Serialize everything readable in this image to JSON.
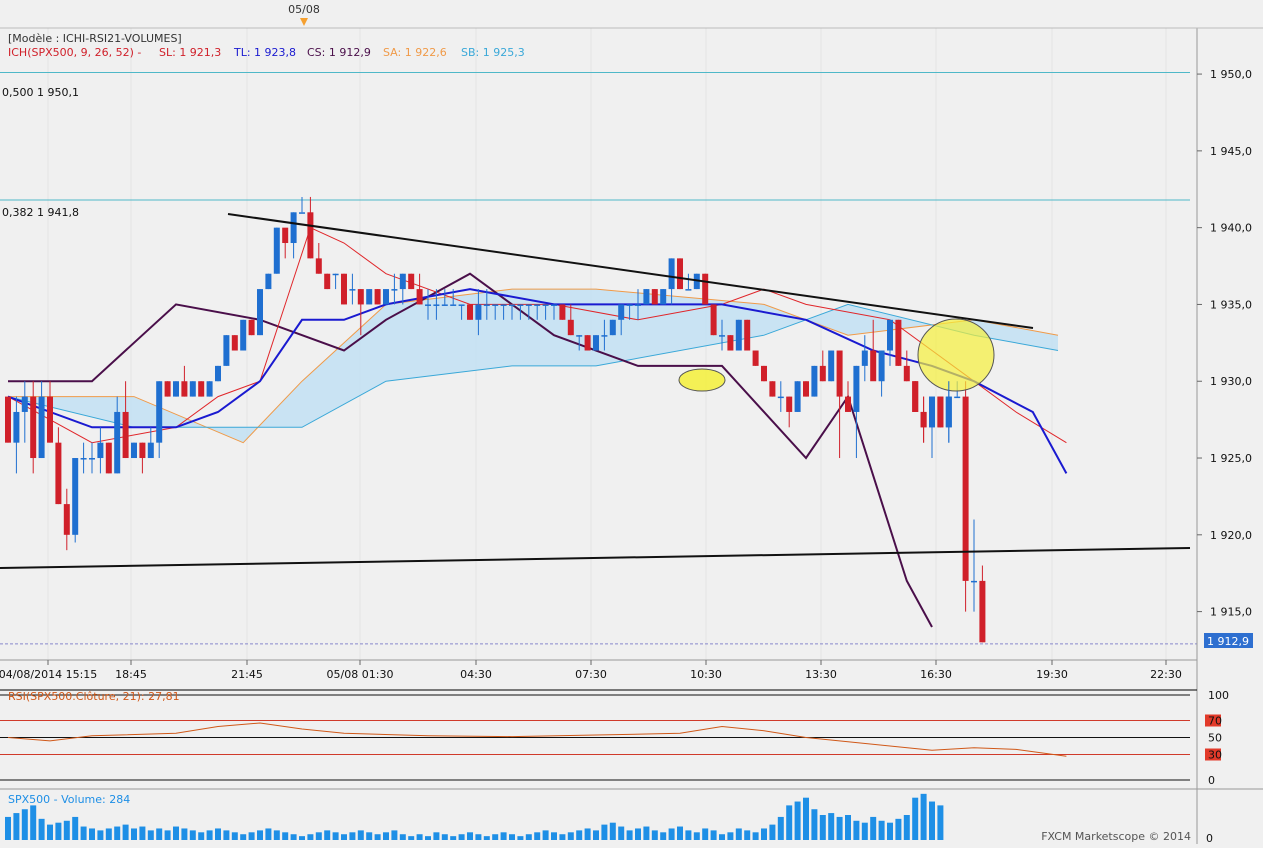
{
  "header": {
    "date_marker": "05/08",
    "model_label": "[Modèle : ICHI-RSI21-VOLUMES]",
    "ichimoku": {
      "title": "ICH(SPX500, 9, 26, 52) -",
      "sl": "SL: 1 921,3",
      "tl": "TL: 1 923,8",
      "cs": "CS: 1 912,9",
      "sa": "SA: 1 922,6",
      "sb": "SB: 1 925,3"
    }
  },
  "fib_levels": [
    {
      "label": "0,500 1 950,1",
      "value": 1950.1
    },
    {
      "label": "0,382 1 941,8",
      "value": 1941.8
    }
  ],
  "price_axis": {
    "ticks": [
      "1 950,0",
      "1 945,0",
      "1 940,0",
      "1 935,0",
      "1 930,0",
      "1 925,0",
      "1 920,0",
      "1 915,0"
    ],
    "tick_values": [
      1950,
      1945,
      1940,
      1935,
      1930,
      1925,
      1920,
      1915
    ],
    "last_price_label": "1 912,9",
    "last_price": 1912.9
  },
  "time_axis": {
    "labels": [
      "04/08/2014 15:15",
      "18:45",
      "21:45",
      "05/08 01:30",
      "04:30",
      "07:30",
      "10:30",
      "13:30",
      "16:30",
      "19:30",
      "22:30"
    ]
  },
  "rsi_panel": {
    "label": "RSI(SPX500.Clôture, 21): 27,81",
    "levels": [
      "100",
      "70",
      "50",
      "30",
      "0"
    ],
    "level_values": [
      100,
      70,
      50,
      30,
      0
    ]
  },
  "volume_panel": {
    "label": "SPX500 - Volume: 284",
    "zero_label": "0",
    "watermark": "FXCM Marketscope © 2014"
  },
  "colors": {
    "bull": "#1f6fd0",
    "bear": "#d0202a",
    "tenkan": "#e0262a",
    "kijun": "#1a1ad0",
    "chikou": "#4a0f4a",
    "senkou_a": "#f09a48",
    "senkou_b": "#3aa8d8",
    "cloud_bull": "#bfe0f4",
    "cloud_bear": "#f6d2b4",
    "fib": "#4fb8c8",
    "volume": "#1e8fe6",
    "rsi": "#d05818",
    "highlight": "#f5f03a"
  },
  "chart_data": {
    "type": "candlestick",
    "price_range": [
      1912.5,
      1953
    ],
    "candles": [
      [
        1929,
        1929,
        1926,
        1926
      ],
      [
        1926,
        1929,
        1924,
        1928
      ],
      [
        1928,
        1930,
        1926,
        1929
      ],
      [
        1929,
        1930,
        1924,
        1925
      ],
      [
        1925,
        1930,
        1925,
        1929
      ],
      [
        1929,
        1930,
        1926,
        1926
      ],
      [
        1926,
        1927,
        1922,
        1922
      ],
      [
        1922,
        1923,
        1919,
        1920
      ],
      [
        1920,
        1925,
        1919.5,
        1925
      ],
      [
        1925,
        1926,
        1924,
        1925
      ],
      [
        1925,
        1926,
        1924,
        1925
      ],
      [
        1925,
        1927,
        1924,
        1926
      ],
      [
        1926,
        1926,
        1924,
        1924
      ],
      [
        1924,
        1929,
        1924,
        1928
      ],
      [
        1928,
        1930,
        1925,
        1925
      ],
      [
        1925,
        1926,
        1925,
        1926
      ],
      [
        1926,
        1926,
        1924,
        1925
      ],
      [
        1925,
        1927,
        1925,
        1926
      ],
      [
        1926,
        1930,
        1925,
        1930
      ],
      [
        1930,
        1930,
        1929,
        1929
      ],
      [
        1929,
        1930,
        1929,
        1930
      ],
      [
        1930,
        1931,
        1929,
        1929
      ],
      [
        1929,
        1930,
        1929,
        1930
      ],
      [
        1930,
        1930,
        1929,
        1929
      ],
      [
        1929,
        1930,
        1929,
        1930
      ],
      [
        1930,
        1931,
        1930,
        1931
      ],
      [
        1931,
        1933,
        1931,
        1933
      ],
      [
        1933,
        1933,
        1932,
        1932
      ],
      [
        1932,
        1934,
        1932,
        1934
      ],
      [
        1934,
        1934,
        1933,
        1933
      ],
      [
        1933,
        1936,
        1933,
        1936
      ],
      [
        1936,
        1937,
        1936,
        1937
      ],
      [
        1937,
        1940,
        1937,
        1940
      ],
      [
        1940,
        1939,
        1938,
        1939
      ],
      [
        1939,
        1941,
        1938,
        1941
      ],
      [
        1941,
        1942,
        1941,
        1941
      ],
      [
        1941,
        1942,
        1938,
        1938
      ],
      [
        1938,
        1939,
        1937,
        1937
      ],
      [
        1937,
        1937,
        1936,
        1936
      ],
      [
        1937,
        1937,
        1936,
        1937
      ],
      [
        1937,
        1937,
        1935,
        1935
      ],
      [
        1936,
        1937,
        1935,
        1936
      ],
      [
        1936,
        1936,
        1933,
        1935
      ],
      [
        1935,
        1936,
        1935,
        1936
      ],
      [
        1936,
        1936,
        1935,
        1935
      ],
      [
        1935,
        1936,
        1935,
        1936
      ],
      [
        1936,
        1937,
        1935,
        1936
      ],
      [
        1936,
        1937,
        1935,
        1937
      ],
      [
        1937,
        1937,
        1936,
        1936
      ],
      [
        1936,
        1937,
        1935,
        1935
      ],
      [
        1935,
        1936,
        1934,
        1935
      ],
      [
        1935,
        1936,
        1934,
        1935
      ],
      [
        1935,
        1936,
        1935,
        1935
      ],
      [
        1935,
        1936,
        1935,
        1935
      ],
      [
        1935,
        1935,
        1934,
        1935
      ],
      [
        1935,
        1935,
        1934,
        1934
      ],
      [
        1934,
        1936,
        1933,
        1935
      ],
      [
        1935,
        1936,
        1934,
        1935
      ],
      [
        1935,
        1935,
        1934,
        1935
      ],
      [
        1935,
        1935,
        1934,
        1935
      ],
      [
        1935,
        1935,
        1934,
        1935
      ],
      [
        1935,
        1935,
        1934,
        1935
      ],
      [
        1935,
        1935,
        1934,
        1935
      ],
      [
        1935,
        1935,
        1934,
        1935
      ],
      [
        1935,
        1935,
        1934,
        1935
      ],
      [
        1935,
        1935,
        1934,
        1935
      ],
      [
        1935,
        1935,
        1934,
        1934
      ],
      [
        1934,
        1935,
        1933,
        1933
      ],
      [
        1933,
        1933,
        1932,
        1933
      ],
      [
        1933,
        1933,
        1932,
        1932
      ],
      [
        1932,
        1933,
        1932,
        1933
      ],
      [
        1933,
        1934,
        1932,
        1933
      ],
      [
        1933,
        1934,
        1933,
        1934
      ],
      [
        1934,
        1935,
        1933,
        1935
      ],
      [
        1935,
        1935,
        1934,
        1935
      ],
      [
        1935,
        1936,
        1934,
        1935
      ],
      [
        1935,
        1936,
        1935,
        1936
      ],
      [
        1936,
        1936,
        1935,
        1935
      ],
      [
        1935,
        1936,
        1935,
        1936
      ],
      [
        1936,
        1938,
        1935,
        1938
      ],
      [
        1938,
        1938,
        1936,
        1936
      ],
      [
        1936,
        1937,
        1936,
        1936
      ],
      [
        1936,
        1937,
        1936,
        1937
      ],
      [
        1937,
        1937,
        1935,
        1935
      ],
      [
        1935,
        1935,
        1933,
        1933
      ],
      [
        1933,
        1934,
        1932,
        1933
      ],
      [
        1933,
        1933,
        1932,
        1932
      ],
      [
        1932,
        1934,
        1932,
        1934
      ],
      [
        1934,
        1934,
        1932,
        1932
      ],
      [
        1932,
        1932,
        1931,
        1931
      ],
      [
        1931,
        1931,
        1930,
        1930
      ],
      [
        1930,
        1930,
        1929,
        1929
      ],
      [
        1929,
        1930,
        1928,
        1929
      ],
      [
        1929,
        1929,
        1927,
        1928
      ],
      [
        1928,
        1930,
        1928,
        1930
      ],
      [
        1930,
        1930,
        1929,
        1929
      ],
      [
        1929,
        1931,
        1929,
        1931
      ],
      [
        1931,
        1932,
        1930,
        1930
      ],
      [
        1930,
        1932,
        1930,
        1932
      ],
      [
        1932,
        1932,
        1925,
        1929
      ],
      [
        1929,
        1930,
        1928,
        1928
      ],
      [
        1928,
        1931,
        1925,
        1931
      ],
      [
        1931,
        1933,
        1930,
        1932
      ],
      [
        1932,
        1934,
        1931,
        1930
      ],
      [
        1930,
        1932,
        1929,
        1932
      ],
      [
        1932,
        1934,
        1931,
        1934
      ],
      [
        1934,
        1934,
        1931,
        1931
      ],
      [
        1931,
        1932,
        1930,
        1930
      ],
      [
        1930,
        1930,
        1928,
        1928
      ],
      [
        1928,
        1929,
        1926,
        1927
      ],
      [
        1927,
        1929,
        1925,
        1929
      ],
      [
        1929,
        1929,
        1927,
        1927
      ],
      [
        1927,
        1930,
        1926,
        1929
      ],
      [
        1929,
        1930,
        1929,
        1929
      ],
      [
        1929,
        1930,
        1915,
        1917
      ],
      [
        1917,
        1921,
        1915,
        1917
      ],
      [
        1917,
        1918,
        1913,
        1913
      ]
    ],
    "tenkan": [
      [
        0,
        1929
      ],
      [
        10,
        1926
      ],
      [
        20,
        1927
      ],
      [
        25,
        1929
      ],
      [
        30,
        1930
      ],
      [
        33,
        1935
      ],
      [
        36,
        1940
      ],
      [
        40,
        1939
      ],
      [
        45,
        1937
      ],
      [
        55,
        1935
      ],
      [
        65,
        1935
      ],
      [
        75,
        1934
      ],
      [
        85,
        1935
      ],
      [
        90,
        1936
      ],
      [
        95,
        1935
      ],
      [
        105,
        1934
      ],
      [
        110,
        1932
      ],
      [
        115,
        1930
      ],
      [
        120,
        1928
      ],
      [
        126,
        1926
      ]
    ],
    "kijun": [
      [
        0,
        1929
      ],
      [
        10,
        1927
      ],
      [
        20,
        1927
      ],
      [
        25,
        1928
      ],
      [
        30,
        1930
      ],
      [
        35,
        1934
      ],
      [
        40,
        1934
      ],
      [
        45,
        1935
      ],
      [
        55,
        1936
      ],
      [
        65,
        1935
      ],
      [
        75,
        1935
      ],
      [
        85,
        1935
      ],
      [
        95,
        1934
      ],
      [
        103,
        1932
      ],
      [
        110,
        1931
      ],
      [
        115,
        1930
      ],
      [
        122,
        1928
      ],
      [
        126,
        1924
      ]
    ],
    "chikou": [
      [
        0,
        1930
      ],
      [
        10,
        1930
      ],
      [
        20,
        1935
      ],
      [
        30,
        1934
      ],
      [
        40,
        1932
      ],
      [
        45,
        1934
      ],
      [
        55,
        1937
      ],
      [
        65,
        1933
      ],
      [
        75,
        1931
      ],
      [
        85,
        1931
      ],
      [
        95,
        1925
      ],
      [
        100,
        1929
      ],
      [
        107,
        1917
      ],
      [
        110,
        1914
      ]
    ],
    "senkou_a": [
      [
        0,
        1929
      ],
      [
        15,
        1929
      ],
      [
        28,
        1926
      ],
      [
        35,
        1930
      ],
      [
        45,
        1935
      ],
      [
        60,
        1936
      ],
      [
        70,
        1936
      ],
      [
        90,
        1935
      ],
      [
        100,
        1933
      ],
      [
        115,
        1934
      ],
      [
        125,
        1933
      ]
    ],
    "senkou_b": [
      [
        0,
        1929
      ],
      [
        15,
        1927
      ],
      [
        28,
        1927
      ],
      [
        35,
        1927
      ],
      [
        45,
        1930
      ],
      [
        60,
        1931
      ],
      [
        70,
        1931
      ],
      [
        90,
        1933
      ],
      [
        100,
        1935
      ],
      [
        115,
        1933
      ],
      [
        125,
        1932
      ]
    ],
    "trendlines": [
      {
        "from": [
          21.8,
          1942.5
        ],
        "to": [
          2109,
          1934.5
        ]
      },
      {
        "from": [
          -1,
          1918.5
        ],
        "to": [
          2120,
          1919.3
        ]
      }
    ],
    "rsi": [
      [
        0,
        50
      ],
      [
        5,
        46
      ],
      [
        10,
        52
      ],
      [
        20,
        55
      ],
      [
        25,
        63
      ],
      [
        30,
        67
      ],
      [
        35,
        60
      ],
      [
        40,
        55
      ],
      [
        50,
        52
      ],
      [
        60,
        51
      ],
      [
        70,
        53
      ],
      [
        80,
        55
      ],
      [
        85,
        63
      ],
      [
        90,
        58
      ],
      [
        95,
        50
      ],
      [
        100,
        45
      ],
      [
        105,
        40
      ],
      [
        110,
        35
      ],
      [
        115,
        38
      ],
      [
        120,
        36
      ],
      [
        126,
        28
      ]
    ],
    "volume": [
      12,
      14,
      16,
      18,
      11,
      8,
      9,
      10,
      12,
      7,
      6,
      5,
      6,
      7,
      8,
      6,
      7,
      5,
      6,
      5,
      7,
      6,
      5,
      4,
      5,
      6,
      5,
      4,
      3,
      4,
      5,
      6,
      5,
      4,
      3,
      2,
      3,
      4,
      5,
      4,
      3,
      4,
      5,
      4,
      3,
      4,
      5,
      3,
      2,
      3,
      2,
      4,
      3,
      2,
      3,
      4,
      3,
      2,
      3,
      4,
      3,
      2,
      3,
      4,
      5,
      4,
      3,
      4,
      5,
      6,
      5,
      8,
      9,
      7,
      5,
      6,
      7,
      5,
      4,
      6,
      7,
      5,
      4,
      6,
      5,
      3,
      4,
      6,
      5,
      4,
      6,
      8,
      12,
      18,
      20,
      22,
      16,
      13,
      14,
      12,
      13,
      10,
      9,
      12,
      10,
      9,
      11,
      13,
      22,
      24,
      20,
      18
    ]
  }
}
